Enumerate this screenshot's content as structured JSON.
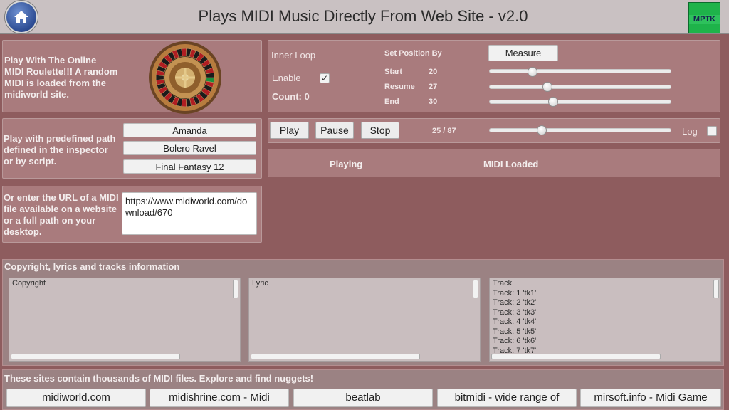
{
  "header": {
    "title": "Plays MIDI Music Directly From Web Site - v2.0",
    "logo_text": "MPTK"
  },
  "roulette": {
    "text": "Play With The Online MIDI Roulette!!! A random MIDI is loaded from the midiworld site."
  },
  "predefined": {
    "text": "Play with predefined path defined in the inspector or by script.",
    "items": [
      "Amanda",
      "Bolero Ravel",
      "Final Fantasy 12"
    ]
  },
  "url": {
    "text": "Or enter the URL of a MIDI  file available on a website or a full path on your desktop.",
    "value": "https://www.midiworld.com/download/670"
  },
  "loop": {
    "title": "Inner Loop",
    "enable_label": "Enable",
    "enabled": true,
    "count_label": "Count: 0",
    "set_position_label": "Set Position By",
    "measure_button": "Measure",
    "start_label": "Start",
    "start_value": "20",
    "resume_label": "Resume",
    "resume_value": "27",
    "end_label": "End",
    "end_value": "30",
    "start_fraction": 0.24,
    "resume_fraction": 0.32,
    "end_fraction": 0.35
  },
  "player": {
    "play_button": "Play",
    "pause_button": "Pause",
    "stop_button": "Stop",
    "position": "25 / 87",
    "position_fraction": 0.29,
    "log_label": "Log",
    "log_checked": false
  },
  "status": {
    "state": "Playing",
    "midi_state": "MIDI Loaded"
  },
  "info": {
    "header": "Copyright, lyrics and tracks information",
    "copyright_label": "Copyright",
    "lyric_label": "Lyric",
    "tracks": [
      "Track",
      "Track: 1 'tk1'",
      "Track: 2 'tk2'",
      "Track: 3 'tk3'",
      "Track: 4 'tk4'",
      "Track: 5 'tk5'",
      "Track: 6 'tk6'",
      "Track: 7 'tk7'"
    ]
  },
  "sites": {
    "header": "These sites contain thousands of MIDI files. Explore and find nuggets!",
    "items": [
      "midiworld.com",
      "midishrine.com - Midi",
      "beatlab",
      "bitmidi -  wide range of",
      "mirsoft.info - Midi Game"
    ]
  },
  "colors": {
    "background": "#8e5c5e",
    "panel": "#a97b7d",
    "header": "#c9c1c2",
    "logo": "#1eb34a"
  }
}
